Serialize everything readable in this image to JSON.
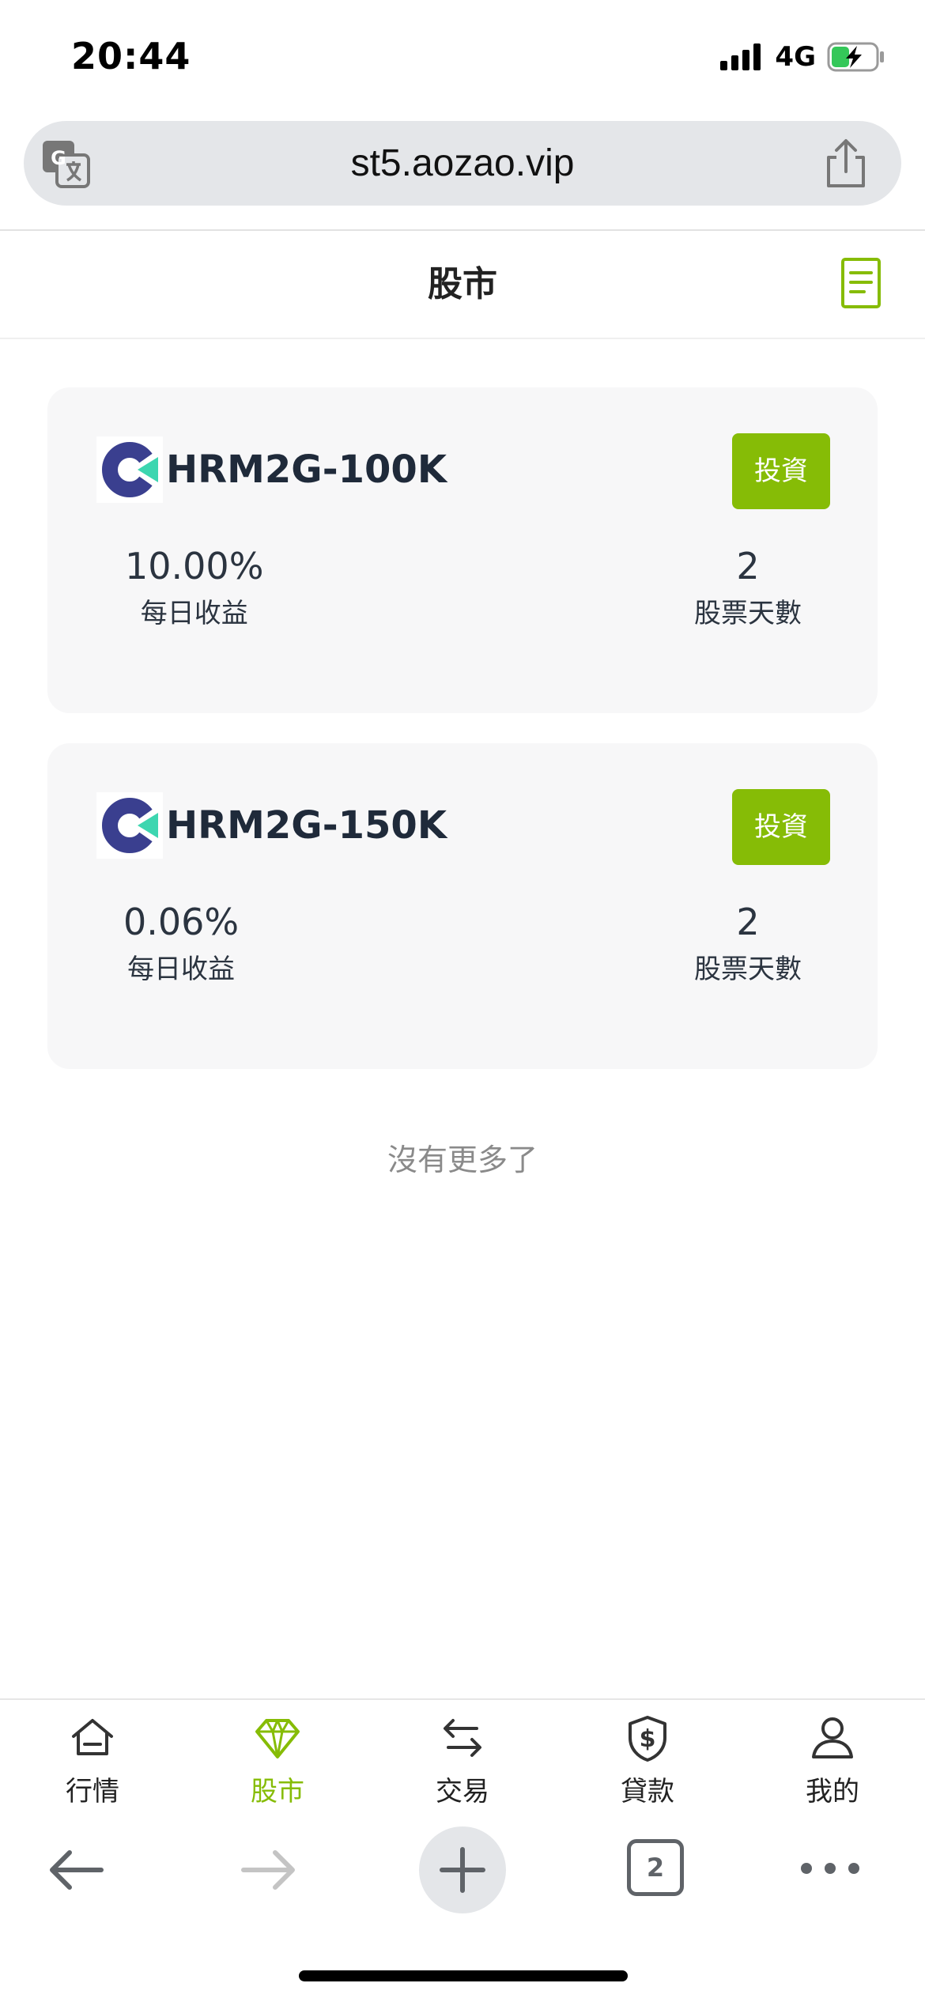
{
  "status_bar": {
    "time": "20:44",
    "network": "4G",
    "battery_icon": "battery-charging-icon"
  },
  "browser": {
    "url": "st5.aozao.vip",
    "tab_count": "2"
  },
  "header": {
    "title": "股市"
  },
  "stocks": [
    {
      "name": "HRM2G-100K",
      "invest_label": "投資",
      "daily_return": "10.00%",
      "daily_return_label": "每日收益",
      "days": "2",
      "days_label": "股票天數"
    },
    {
      "name": "HRM2G-150K",
      "invest_label": "投資",
      "daily_return": "0.06%",
      "daily_return_label": "每日收益",
      "days": "2",
      "days_label": "股票天數"
    }
  ],
  "list_end_text": "沒有更多了",
  "nav": {
    "items": [
      {
        "label": "行情",
        "icon": "home-icon",
        "active": false
      },
      {
        "label": "股市",
        "icon": "diamond-icon",
        "active": true
      },
      {
        "label": "交易",
        "icon": "swap-arrows-icon",
        "active": false
      },
      {
        "label": "貸款",
        "icon": "dollar-shield-icon",
        "active": false
      },
      {
        "label": "我的",
        "icon": "user-icon",
        "active": false
      }
    ]
  },
  "colors": {
    "accent": "#86bc06",
    "text": "#2b3440",
    "card_bg": "#f7f7f8",
    "logo_dark": "#3a3f8f",
    "logo_teal": "#3dd6b0"
  }
}
